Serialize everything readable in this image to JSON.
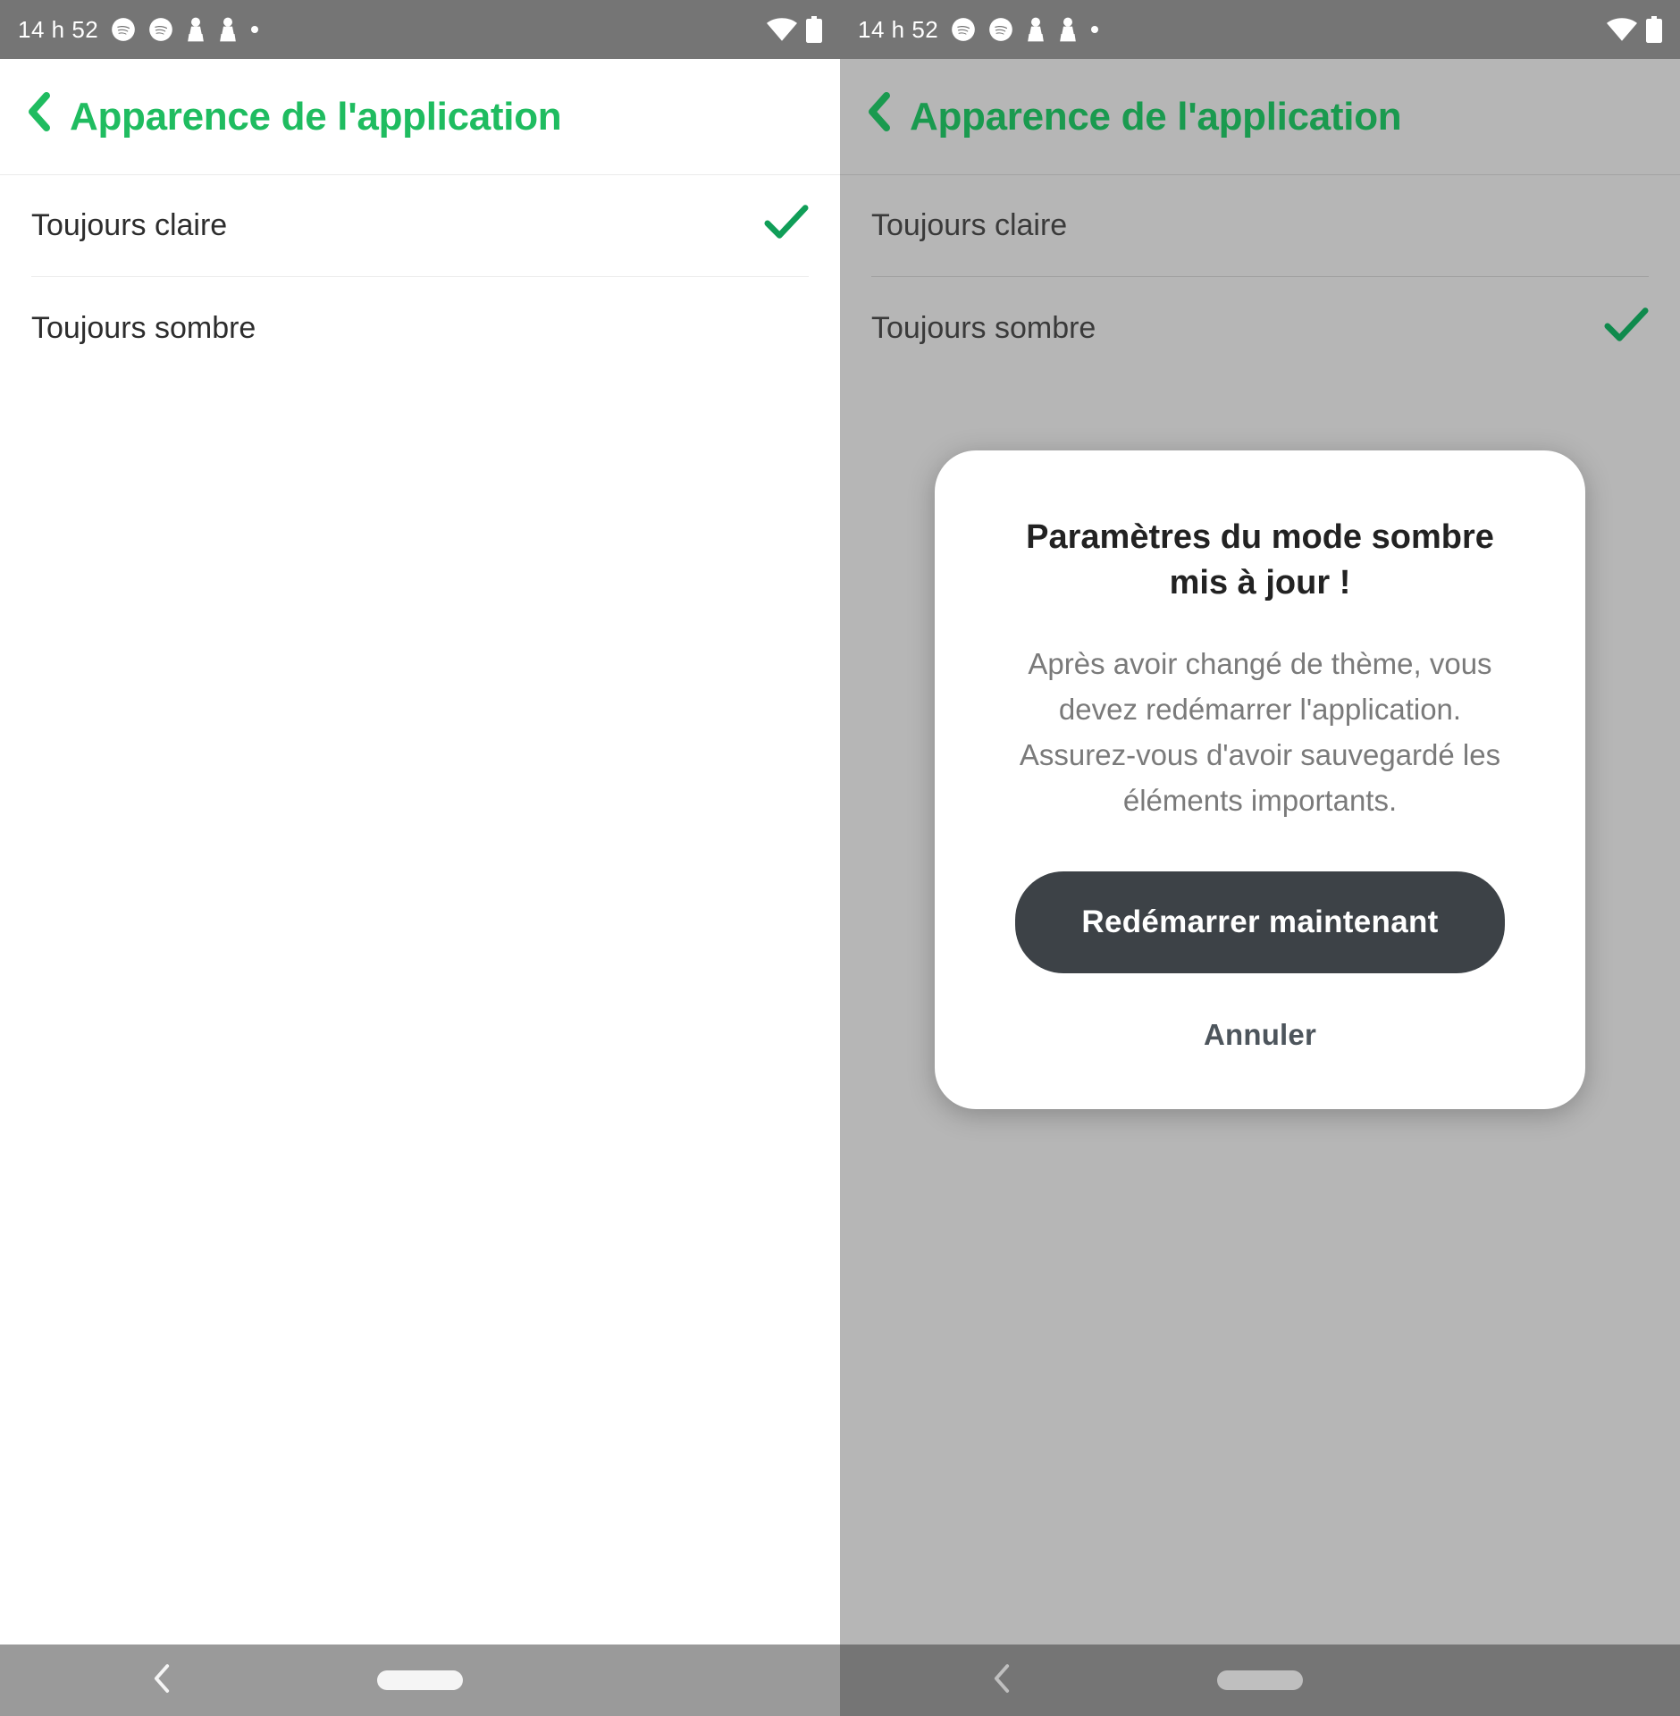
{
  "status": {
    "time": "14 h 52"
  },
  "header": {
    "title": "Apparence de l'application"
  },
  "options": {
    "light": "Toujours claire",
    "dark": "Toujours sombre"
  },
  "left": {
    "selected": "light"
  },
  "right": {
    "selected": "dark"
  },
  "dialog": {
    "title": "Paramètres du mode sombre mis à jour !",
    "body": "Après avoir changé de thème, vous devez redémarrer l'application. Assurez-vous d'avoir sauvegardé les éléments importants.",
    "primary": "Redémarrer maintenant",
    "secondary": "Annuler"
  },
  "colors": {
    "accent": "#1fbc60",
    "check": "#109e58"
  }
}
